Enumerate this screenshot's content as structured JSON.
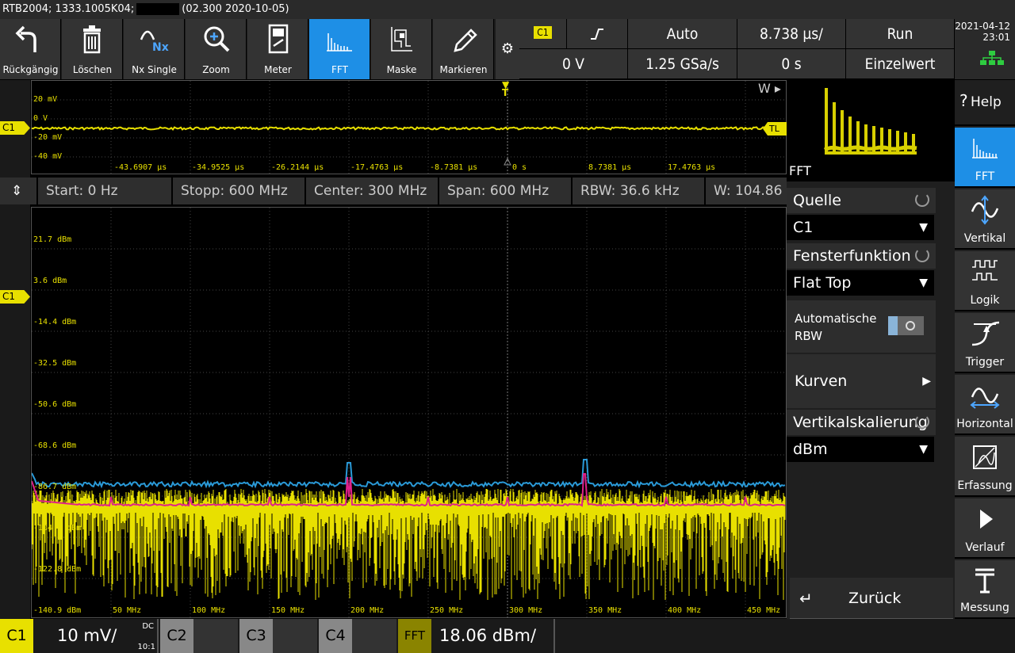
{
  "titlebar": {
    "prefix": "RTB2004; 1333.1005K04;",
    "suffix": "(02.300 2020-10-05)"
  },
  "toolbar": {
    "buttons": [
      {
        "label": "Rückgängig",
        "icon": "undo-icon"
      },
      {
        "label": "Löschen",
        "icon": "trash-icon"
      },
      {
        "label": "Nx Single",
        "icon": "nx-single-icon"
      },
      {
        "label": "Zoom",
        "icon": "zoom-icon"
      },
      {
        "label": "Meter",
        "icon": "meter-icon"
      },
      {
        "label": "FFT",
        "icon": "fft-icon"
      },
      {
        "label": "Maske",
        "icon": "mask-icon"
      },
      {
        "label": "Markieren",
        "icon": "marker-pen-icon"
      }
    ]
  },
  "status": {
    "channel": "C1",
    "trigger_level": "0 V",
    "mode": "Auto",
    "sample_rate": "1.25 GSa/s",
    "timebase": "8.738 µs/",
    "offset": "0 s",
    "run": "Run",
    "single": "Einzelwert"
  },
  "clock": {
    "date": "2021-04-12",
    "time": "23:01"
  },
  "topwave": {
    "ylabels": [
      "20 mV",
      "0 V",
      "-20 mV",
      "-40 mV"
    ],
    "xlabels": [
      "-43.6907 µs",
      "-34.9525 µs",
      "-26.2144 µs",
      "-17.4763 µs",
      "-8.7381 µs",
      "0 s",
      "8.7381 µs",
      "17.4763 µs"
    ],
    "w_label": "W",
    "t_label": "T",
    "tl_label": "TL",
    "ch_label": "C1"
  },
  "fftinfo": {
    "start": "Start: 0 Hz",
    "stop": "Stopp: 600 MHz",
    "center": "Center: 300 MHz",
    "span": "Span: 600 MHz",
    "rbw": "RBW: 36.6 kHz",
    "w": "W: 104.86 µ"
  },
  "fftplot": {
    "ylabels": [
      "21.7 dBm",
      "3.6 dBm",
      "-14.4 dBm",
      "-32.5 dBm",
      "-50.6 dBm",
      "-68.6 dBm",
      "-86.7 dBm",
      "-104.8 dBm",
      "-122.8 dBm",
      "-140.9 dBm"
    ],
    "xlabels": [
      "50 MHz",
      "100 MHz",
      "150 MHz",
      "200 MHz",
      "250 MHz",
      "300 MHz",
      "350 MHz",
      "400 MHz",
      "450 MHz"
    ],
    "ch_label": "C1"
  },
  "rightpanel": {
    "preview_label": "FFT",
    "source_label": "Quelle",
    "source_value": "C1",
    "window_label": "Fensterfunktion",
    "window_value": "Flat Top",
    "auto_rbw_label_1": "Automatische",
    "auto_rbw_label_2": "RBW",
    "curves_label": "Kurven",
    "vscale_label": "Vertikalskalierung",
    "vscale_value": "dBm",
    "back_label": "Zurück"
  },
  "sidenav": [
    {
      "label": "Help",
      "icon": "help-icon"
    },
    {
      "label": "FFT",
      "icon": "fft-icon"
    },
    {
      "label": "Vertikal",
      "icon": "vertical-icon"
    },
    {
      "label": "Logik",
      "icon": "logic-icon"
    },
    {
      "label": "Trigger",
      "icon": "trigger-icon"
    },
    {
      "label": "Horizontal",
      "icon": "horizontal-icon"
    },
    {
      "label": "Erfassung",
      "icon": "acquisition-icon"
    },
    {
      "label": "Verlauf",
      "icon": "play-icon"
    },
    {
      "label": "Messung",
      "icon": "measure-icon"
    }
  ],
  "bottombar": {
    "c1": "C1",
    "c1_scale": "10 mV/",
    "c1_coupling": "DC",
    "c1_probe": "10:1",
    "c2": "C2",
    "c3": "C3",
    "c4": "C4",
    "fft": "FFT",
    "fft_scale": "18.06 dBm/"
  },
  "colors": {
    "yellow": "#e8e000",
    "blue": "#1e8fe6",
    "magenta": "#e0208a",
    "trace_blue": "#2a9ad8"
  }
}
